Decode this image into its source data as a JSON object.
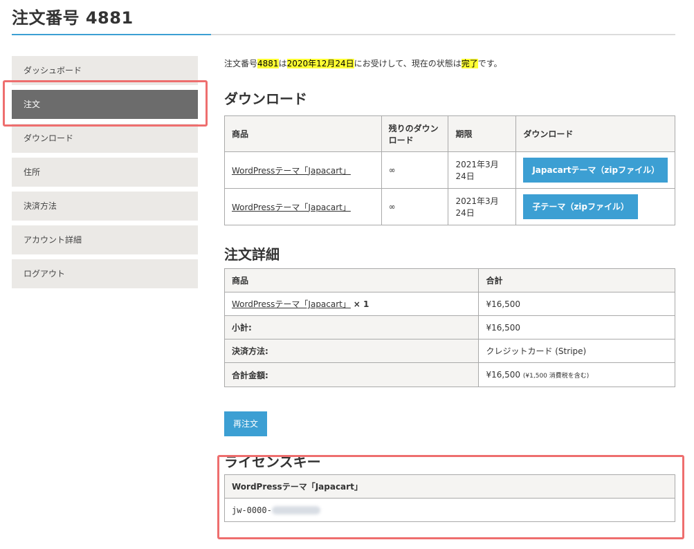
{
  "page": {
    "title": "注文番号 4881"
  },
  "sidebar": {
    "items": [
      {
        "label": "ダッシュボード"
      },
      {
        "label": "注文"
      },
      {
        "label": "ダウンロード"
      },
      {
        "label": "住所"
      },
      {
        "label": "決済方法"
      },
      {
        "label": "アカウント詳細"
      },
      {
        "label": "ログアウト"
      }
    ]
  },
  "intro": {
    "prefix": "注文番号",
    "order_number": "4881",
    "mid1": "は",
    "date": "2020年12月24日",
    "mid2": "にお受けして、現在の状態は",
    "status": "完了",
    "suffix": "です。"
  },
  "downloads": {
    "title": "ダウンロード",
    "headers": [
      "商品",
      "残りのダウンロード",
      "期限",
      "ダウンロード"
    ],
    "rows": [
      {
        "product": "WordPressテーマ「Japacart」",
        "remaining": "∞",
        "expires": "2021年3月24日",
        "button": "Japacartテーマ（zipファイル）"
      },
      {
        "product": "WordPressテーマ「Japacart」",
        "remaining": "∞",
        "expires": "2021年3月24日",
        "button": "子テーマ（zipファイル）"
      }
    ]
  },
  "order_details": {
    "title": "注文詳細",
    "headers": [
      "商品",
      "合計"
    ],
    "item": {
      "product": "WordPressテーマ「Japacart」",
      "qty": "× 1",
      "total": "¥16,500"
    },
    "subtotal": {
      "label": "小計:",
      "value": "¥16,500"
    },
    "payment": {
      "label": "決済方法:",
      "value": "クレジットカード (Stripe)"
    },
    "grand_total": {
      "label": "合計金額:",
      "value": "¥16,500",
      "tax_note": "(¥1,500 消費税を含む)"
    }
  },
  "reorder": {
    "label": "再注文"
  },
  "license": {
    "title": "ライセンスキー",
    "product": "WordPressテーマ「Japacart」",
    "key_prefix": "jw-0000-"
  },
  "colors": {
    "accent": "#3c9fd3",
    "active_sidebar": "#6c6c6c",
    "highlight": "#ffff33",
    "annotation_box": "#ee6e6e"
  }
}
